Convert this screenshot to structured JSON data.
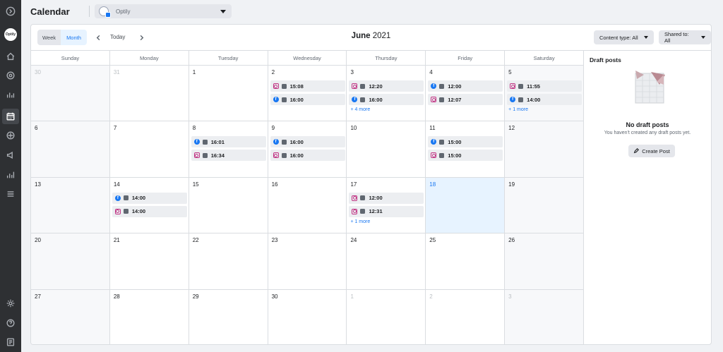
{
  "header": {
    "title": "Calendar",
    "account": {
      "name": "Optily",
      "avatar_text": "Optily"
    }
  },
  "rail": {
    "icons": [
      "expand-icon",
      "home-icon",
      "notifications-icon",
      "activity-icon",
      "calendar-icon",
      "content-icon",
      "ads-icon",
      "insights-icon",
      "menu-icon",
      "settings-icon",
      "help-icon",
      "pages-icon"
    ],
    "active": "calendar-icon"
  },
  "toolbar": {
    "week_label": "Week",
    "month_label": "Month",
    "today_label": "Today",
    "month": "June",
    "year": "2021",
    "content_type_label": "Content type: All",
    "shared_to_label": "Shared to: All"
  },
  "days_of_week": [
    "Sunday",
    "Monday",
    "Tuesday",
    "Wednesday",
    "Thursday",
    "Friday",
    "Saturday"
  ],
  "weeks": [
    [
      {
        "day": "30",
        "other": true,
        "gray": true,
        "posts": []
      },
      {
        "day": "31",
        "other": true,
        "gray": false,
        "posts": []
      },
      {
        "day": "1",
        "posts": []
      },
      {
        "day": "2",
        "posts": [
          {
            "platform": "ig",
            "time": "15:08"
          },
          {
            "platform": "fb",
            "time": "16:00"
          }
        ]
      },
      {
        "day": "3",
        "posts": [
          {
            "platform": "ig",
            "time": "12:20"
          },
          {
            "platform": "fb",
            "time": "16:00"
          }
        ],
        "more": "+ 4 more"
      },
      {
        "day": "4",
        "posts": [
          {
            "platform": "fb",
            "time": "12:00"
          },
          {
            "platform": "ig",
            "time": "12:07"
          }
        ]
      },
      {
        "day": "5",
        "gray": true,
        "posts": [
          {
            "platform": "ig",
            "time": "11:55"
          },
          {
            "platform": "fb",
            "time": "14:00"
          }
        ],
        "more": "+ 1 more"
      }
    ],
    [
      {
        "day": "6",
        "gray": true,
        "posts": []
      },
      {
        "day": "7",
        "posts": []
      },
      {
        "day": "8",
        "posts": [
          {
            "platform": "fb",
            "time": "16:01"
          },
          {
            "platform": "ig",
            "time": "16:34"
          }
        ]
      },
      {
        "day": "9",
        "posts": [
          {
            "platform": "fb",
            "time": "16:00"
          },
          {
            "platform": "ig",
            "time": "16:00"
          }
        ]
      },
      {
        "day": "10",
        "posts": []
      },
      {
        "day": "11",
        "posts": [
          {
            "platform": "fb",
            "time": "15:00"
          },
          {
            "platform": "ig",
            "time": "15:00"
          }
        ]
      },
      {
        "day": "12",
        "gray": true,
        "posts": []
      }
    ],
    [
      {
        "day": "13",
        "gray": true,
        "posts": []
      },
      {
        "day": "14",
        "posts": [
          {
            "platform": "fb",
            "time": "14:00"
          },
          {
            "platform": "ig",
            "time": "14:00"
          }
        ]
      },
      {
        "day": "15",
        "posts": []
      },
      {
        "day": "16",
        "posts": []
      },
      {
        "day": "17",
        "posts": [
          {
            "platform": "ig",
            "time": "12:00"
          },
          {
            "platform": "ig",
            "time": "12:31"
          }
        ],
        "more": "+ 1 more"
      },
      {
        "day": "18",
        "today": true,
        "posts": []
      },
      {
        "day": "19",
        "gray": true,
        "posts": []
      }
    ],
    [
      {
        "day": "20",
        "gray": true,
        "posts": []
      },
      {
        "day": "21",
        "posts": []
      },
      {
        "day": "22",
        "posts": []
      },
      {
        "day": "23",
        "posts": []
      },
      {
        "day": "24",
        "posts": []
      },
      {
        "day": "25",
        "posts": []
      },
      {
        "day": "26",
        "gray": true,
        "posts": []
      }
    ],
    [
      {
        "day": "27",
        "gray": true,
        "posts": []
      },
      {
        "day": "28",
        "posts": []
      },
      {
        "day": "29",
        "posts": []
      },
      {
        "day": "30",
        "posts": []
      },
      {
        "day": "1",
        "other": true,
        "posts": []
      },
      {
        "day": "2",
        "other": true,
        "posts": []
      },
      {
        "day": "3",
        "other": true,
        "gray": true,
        "posts": []
      }
    ]
  ],
  "drafts": {
    "title": "Draft posts",
    "empty_title": "No draft posts",
    "empty_sub": "You haven't created any draft posts yet.",
    "create_label": "Create Post"
  },
  "colors": {
    "accent": "#1877f2",
    "today_bg": "#e7f3ff",
    "rail_bg": "#2e3033",
    "instagram": "#c13584"
  }
}
